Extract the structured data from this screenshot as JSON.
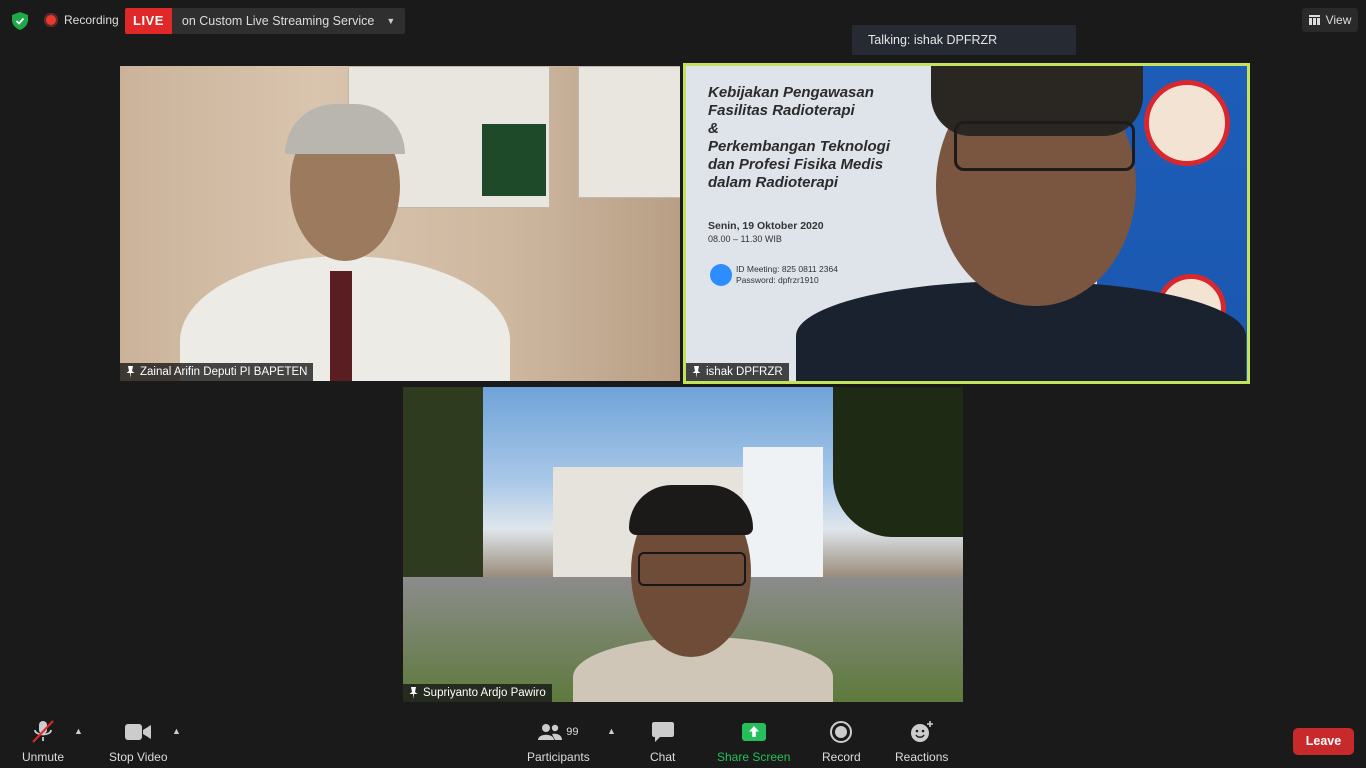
{
  "topbar": {
    "recording_label": "Recording",
    "live_label": "LIVE",
    "live_service": "on Custom Live Streaming Service",
    "view_label": "View",
    "talking": "Talking: ishak DPFRZR"
  },
  "tiles": [
    {
      "name": "Zainal Arifin Deputi PI BAPETEN"
    },
    {
      "name": "ishak DPFRZR",
      "active_speaker": true
    },
    {
      "name": "Supriyanto Ardjo Pawiro"
    }
  ],
  "slide": {
    "title_lines": [
      "Kebijakan Pengawasan",
      "Fasilitas Radioterapi",
      "&",
      "Perkembangan Teknologi",
      "dan Profesi Fisika Medis",
      "dalam Radioterapi"
    ],
    "date": "Senin, 19 Oktober 2020",
    "time": "08.00 – 11.30 WIB",
    "meeting_id": "ID Meeting: 825 0811 2364",
    "password": "Password: dpfrzr1910"
  },
  "toolbar": {
    "unmute": "Unmute",
    "stop_video": "Stop Video",
    "participants": "Participants",
    "participants_count": "99",
    "chat": "Chat",
    "share_screen": "Share Screen",
    "record": "Record",
    "reactions": "Reactions",
    "leave": "Leave"
  },
  "colors": {
    "live": "#e02828",
    "active_border": "#c3e35b",
    "share": "#25c05b",
    "leave": "#c8292a"
  }
}
